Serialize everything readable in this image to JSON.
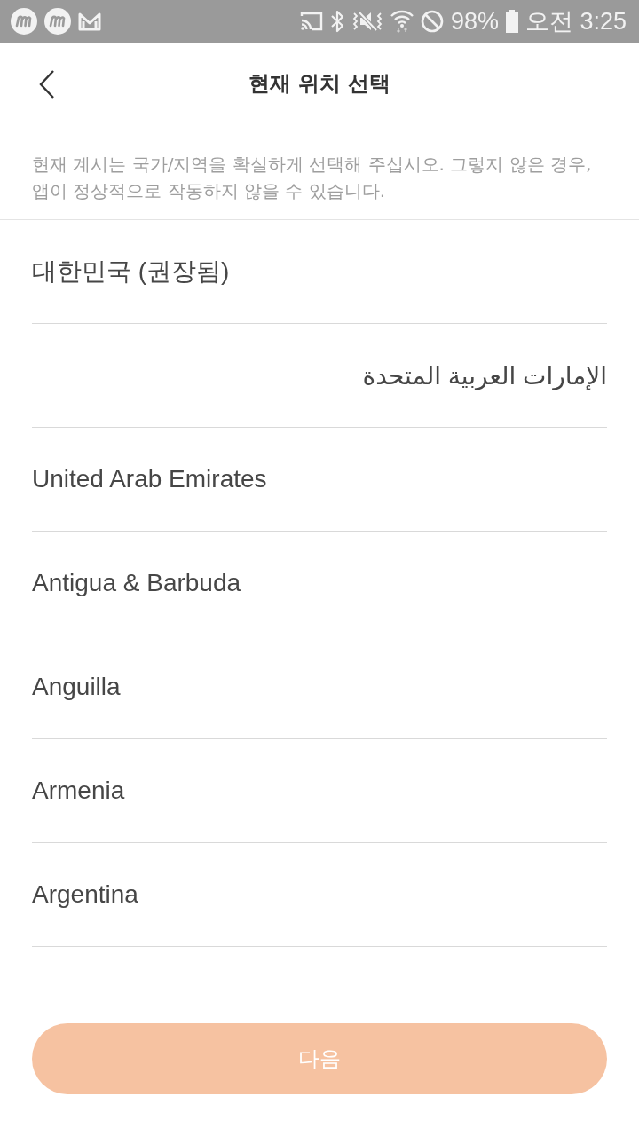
{
  "status_bar": {
    "battery": "98%",
    "time": "오전 3:25"
  },
  "header": {
    "title": "현재 위치 선택"
  },
  "description": "현재 계시는 국가/지역을 확실하게 선택해 주십시오. 그렇지 않은 경우, 앱이 정상적으로 작동하지 않을 수 있습니다.",
  "countries": [
    {
      "name": "대한민국 (권장됨)",
      "selected": false
    },
    {
      "name": "الإمارات العربية المتحدة",
      "selected": false
    },
    {
      "name": "United Arab Emirates",
      "selected": false
    },
    {
      "name": "Antigua & Barbuda",
      "selected": false
    },
    {
      "name": "Anguilla",
      "selected": false
    },
    {
      "name": "Armenia",
      "selected": false
    },
    {
      "name": "Argentina",
      "selected": false
    }
  ],
  "next_button": {
    "label": "다음",
    "disabled": true
  }
}
